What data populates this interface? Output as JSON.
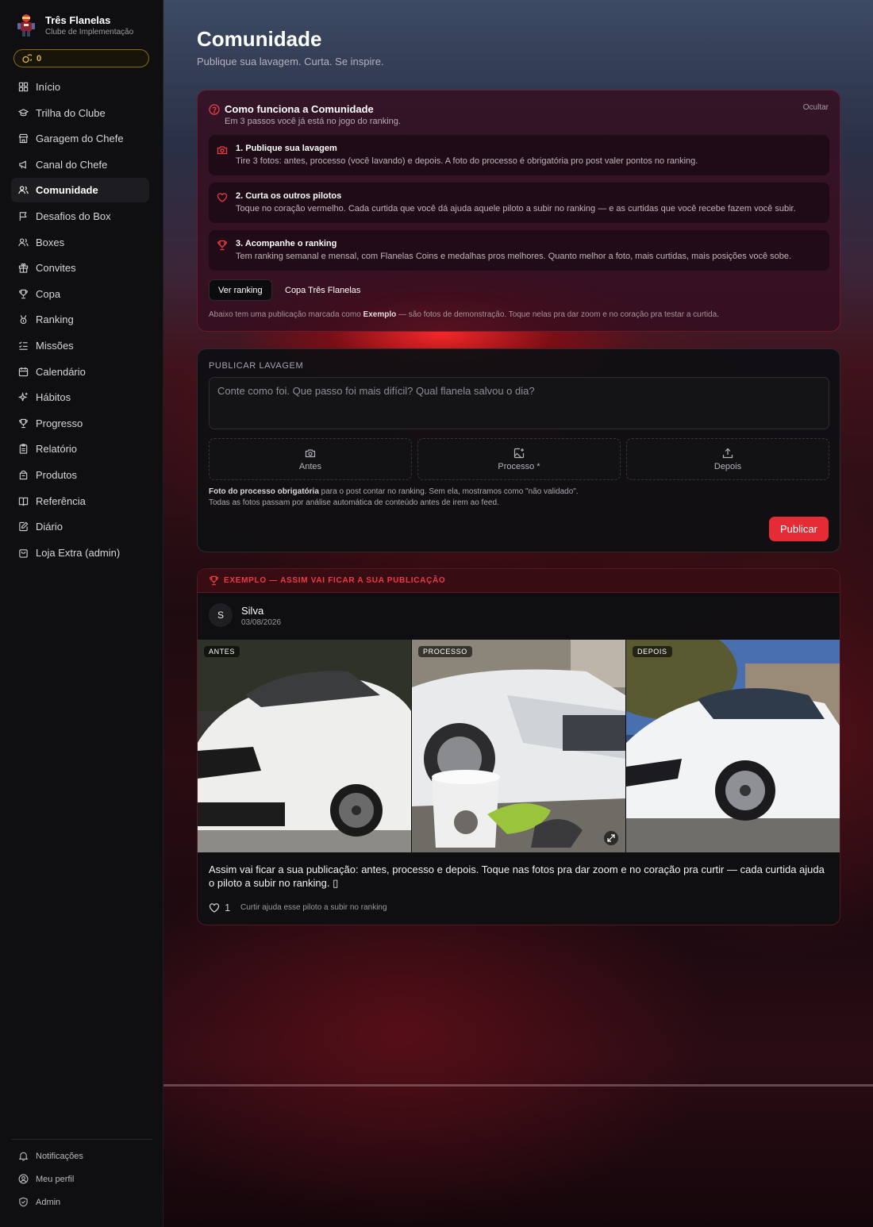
{
  "brand": {
    "title": "Três Flanelas",
    "subtitle": "Clube de Implementação"
  },
  "coins": "0",
  "nav": [
    {
      "label": "Início",
      "icon": "grid-icon"
    },
    {
      "label": "Trilha do Clube",
      "icon": "graduation-cap-icon"
    },
    {
      "label": "Garagem do Chefe",
      "icon": "store-icon"
    },
    {
      "label": "Canal do Chefe",
      "icon": "megaphone-icon"
    },
    {
      "label": "Comunidade",
      "icon": "users-icon",
      "active": true
    },
    {
      "label": "Desafios do Box",
      "icon": "flag-icon"
    },
    {
      "label": "Boxes",
      "icon": "users-icon"
    },
    {
      "label": "Convites",
      "icon": "gift-icon"
    },
    {
      "label": "Copa",
      "icon": "trophy-icon"
    },
    {
      "label": "Ranking",
      "icon": "medal-icon"
    },
    {
      "label": "Missões",
      "icon": "list-checks-icon"
    },
    {
      "label": "Calendário",
      "icon": "calendar-icon"
    },
    {
      "label": "Hábitos",
      "icon": "sparkles-icon"
    },
    {
      "label": "Progresso",
      "icon": "trophy-icon"
    },
    {
      "label": "Relatório",
      "icon": "clipboard-icon"
    },
    {
      "label": "Produtos",
      "icon": "package-icon"
    },
    {
      "label": "Referência",
      "icon": "book-icon"
    },
    {
      "label": "Diário",
      "icon": "notebook-pen-icon"
    },
    {
      "label": "Loja Extra (admin)",
      "icon": "shopping-bag-icon"
    }
  ],
  "bottom_nav": [
    {
      "label": "Notificações",
      "icon": "bell-icon"
    },
    {
      "label": "Meu perfil",
      "icon": "user-circle-icon"
    },
    {
      "label": "Admin",
      "icon": "shield-icon"
    }
  ],
  "page": {
    "title": "Comunidade",
    "subtitle": "Publique sua lavagem. Curta. Se inspire."
  },
  "how": {
    "title": "Como funciona a Comunidade",
    "subtitle": "Em 3 passos você já está no jogo do ranking.",
    "hide": "Ocultar",
    "steps": [
      {
        "title": "1. Publique sua lavagem",
        "text": "Tire 3 fotos: antes, processo (você lavando) e depois. A foto do processo é obrigatória pro post valer pontos no ranking.",
        "icon": "camera-icon"
      },
      {
        "title": "2. Curta os outros pilotos",
        "text": "Toque no coração vermelho. Cada curtida que você dá ajuda aquele piloto a subir no ranking — e as curtidas que você recebe fazem você subir.",
        "icon": "heart-icon"
      },
      {
        "title": "3. Acompanhe o ranking",
        "text": "Tem ranking semanal e mensal, com Flanelas Coins e medalhas pros melhores. Quanto melhor a foto, mais curtidas, mais posições você sobe.",
        "icon": "trophy-icon"
      }
    ],
    "btn_ranking": "Ver ranking",
    "btn_copa": "Copa Três Flanelas",
    "note_pre": "Abaixo tem uma publicação marcada como ",
    "note_bold": "Exemplo",
    "note_post": " — são fotos de demonstração. Toque nelas pra dar zoom e no coração pra testar a curtida."
  },
  "publish": {
    "label": "PUBLICAR LAVAGEM",
    "placeholder": "Conte como foi. Que passo foi mais difícil? Qual flanela salvou o dia?",
    "slots": [
      {
        "label": "Antes",
        "icon": "camera-icon"
      },
      {
        "label": "Processo *",
        "icon": "image-plus-icon"
      },
      {
        "label": "Depois",
        "icon": "upload-icon"
      }
    ],
    "note1_bold": "Foto do processo obrigatória",
    "note1_rest": " para o post contar no ranking. Sem ela, mostramos como \"não validado\".",
    "note2": "Todas as fotos passam por análise automática de conteúdo antes de irem ao feed.",
    "button": "Publicar"
  },
  "post": {
    "banner": "EXEMPLO — ASSIM VAI FICAR A SUA PUBLICAÇÃO",
    "avatar_initial": "S",
    "author": "Silva",
    "date": "03/08/2026",
    "photos": [
      {
        "tag": "ANTES"
      },
      {
        "tag": "PROCESSO"
      },
      {
        "tag": "DEPOIS"
      }
    ],
    "caption": "Assim vai ficar a sua publicação: antes, processo e depois. Toque nas fotos pra dar zoom e no coração pra curtir — cada curtida ajuda o piloto a subir no ranking. ▯",
    "likes": "1",
    "likes_hint": "Curtir ajuda esse piloto a subir no ranking"
  },
  "colors": {
    "accent": "#e52b35",
    "coin": "#e7b73a"
  }
}
